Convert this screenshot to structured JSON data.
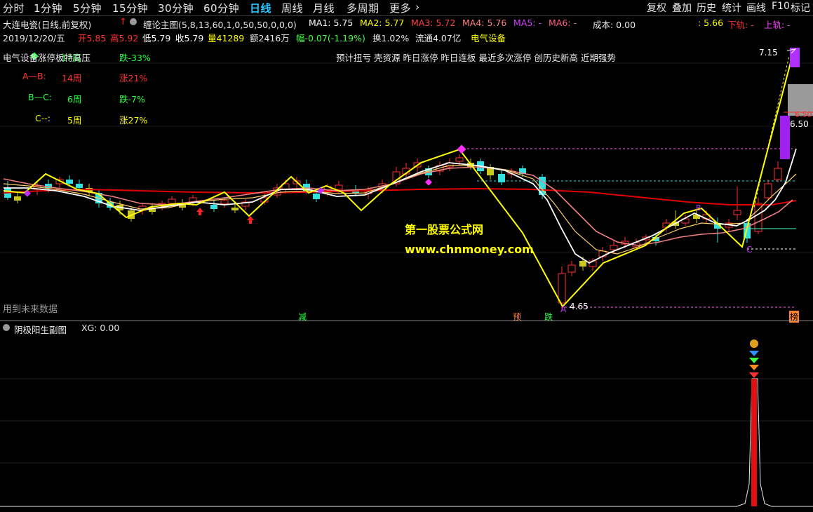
{
  "toolbar": {
    "periods": [
      "分时",
      "1分钟",
      "5分钟",
      "15分钟",
      "30分钟",
      "60分钟",
      "日线",
      "周线",
      "月线",
      "多周期",
      "更多"
    ],
    "more_arrow": "›",
    "right_buttons": [
      "复权",
      "叠加",
      "历史",
      "统计",
      "画线",
      "F10",
      "标记"
    ]
  },
  "header": {
    "stock_title": "大连电瓷(日线,前复权)",
    "indicator_name": "缠论主图(5,8,13,60,1,0,50,50,0,0,0)",
    "ma1": "MA1: 5.75",
    "ma2": "MA2: 5.77",
    "ma3": "MA3: 5.72",
    "ma4": "MA4: 5.76",
    "ma5": "MA5: -",
    "ma6": "MA6: -",
    "cost": "成本: 0.00",
    "right_val": ": 5.66",
    "lower_rail": "下轨: -",
    "upper_rail": "上轨: -"
  },
  "quote": {
    "date": "2019/12/20/五",
    "open": "开5.85",
    "high": "高5.92",
    "low": "低5.79",
    "close": "收5.79",
    "volume": "量41289",
    "amount": "额2416万",
    "change": "幅-0.07(-1.19%)",
    "turnover": "换1.02%",
    "float": "流通4.07亿",
    "sector": "电气设备"
  },
  "stats": [
    {
      "label": "电气设备",
      "period": "17周",
      "result": "跌-33%"
    },
    {
      "label": "A—B:",
      "period": "14周",
      "result": "涨21%"
    },
    {
      "label": "B—C:",
      "period": "6周",
      "result": "跌-7%"
    },
    {
      "label": "C--:",
      "period": "5周",
      "result": "涨27%"
    }
  ],
  "stats_overlay": "涨停板特高压",
  "signal_bar": "预计扭亏  壳资源  昨日涨停  昨日连板  最近多次涨停  创历史新高  近期强势",
  "watermark": {
    "name": "第一股票公式网",
    "url": "www.chnmoney.com"
  },
  "price_labels": {
    "p715": "7.15",
    "p650a": "6.50",
    "p650b": "6.50",
    "p465": "4.65"
  },
  "point_labels": {
    "A": "A",
    "C": "C",
    "B": "B"
  },
  "bottom_note": "用到未来数据",
  "bottom_tags": [
    "减",
    "预",
    "跌",
    "榜"
  ],
  "subchart": {
    "title": "阴极阳生副图",
    "xg": "XG: 0.00"
  },
  "colors": {
    "up": "#ff3030",
    "down": "#33e0e0",
    "ma_white": "#ffffff",
    "ma_red": "#e00000",
    "zigzag": "#ffff00",
    "accent": "#29c6ff",
    "purple": "#a020f0"
  }
}
